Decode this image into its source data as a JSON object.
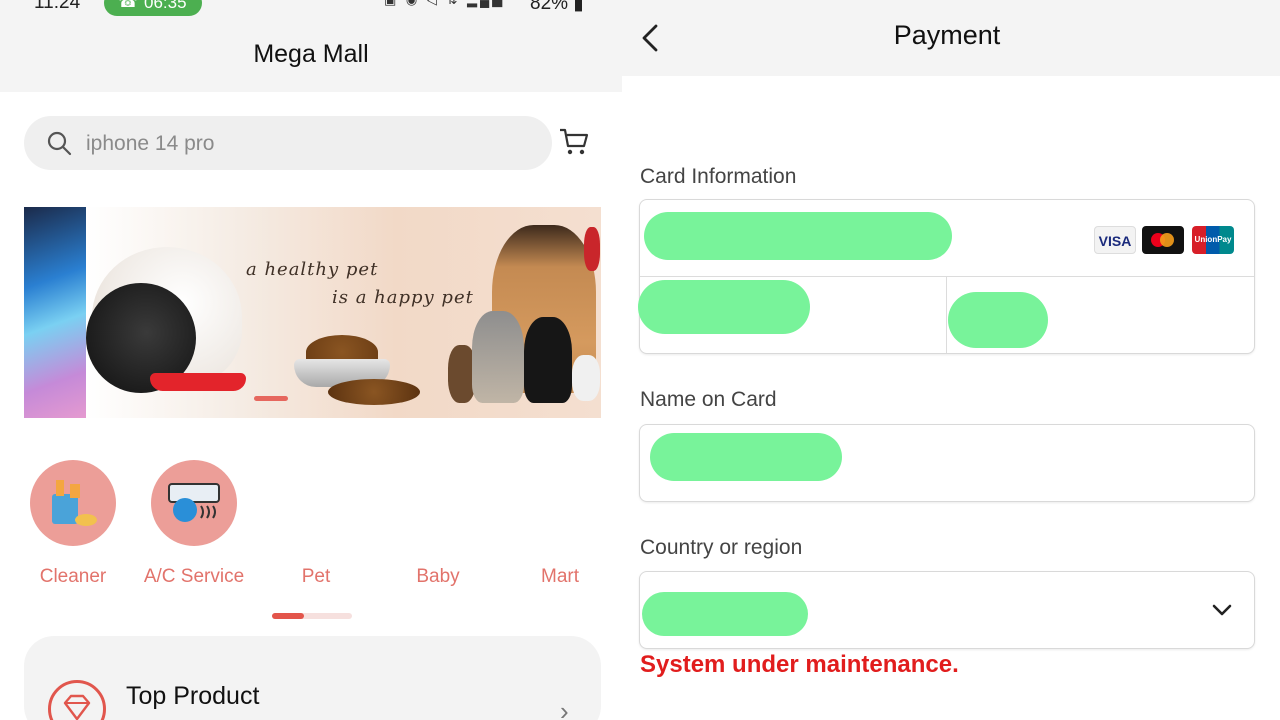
{
  "left_screen": {
    "status_bar": {
      "time": "11:24",
      "call_duration": "06:35",
      "battery": "82%"
    },
    "app_title": "Mega Mall",
    "search": {
      "placeholder": "iphone 14 pro"
    },
    "banner": {
      "line1": "a healthy pet",
      "line2": "is a happy pet"
    },
    "categories": [
      {
        "label": "Cleaner",
        "icon": "cleaning-supplies-icon"
      },
      {
        "label": "A/C Service",
        "icon": "air-conditioner-icon"
      },
      {
        "label": "Pet",
        "icon": ""
      },
      {
        "label": "Baby",
        "icon": ""
      },
      {
        "label": "Mart",
        "icon": ""
      }
    ],
    "top_product": {
      "title": "Top Product"
    }
  },
  "right_screen": {
    "title": "Payment",
    "card_information_label": "Card Information",
    "card_logos": [
      "VISA",
      "Mastercard",
      "UnionPay"
    ],
    "name_on_card_label": "Name on Card",
    "country_label": "Country or region",
    "error_message": "System under maintenance."
  },
  "colors": {
    "accent": "#e3554b",
    "category_circle": "#ec9e98",
    "error": "#e11d1d",
    "redaction": "#78f39a",
    "call_pill": "#4caf50"
  }
}
